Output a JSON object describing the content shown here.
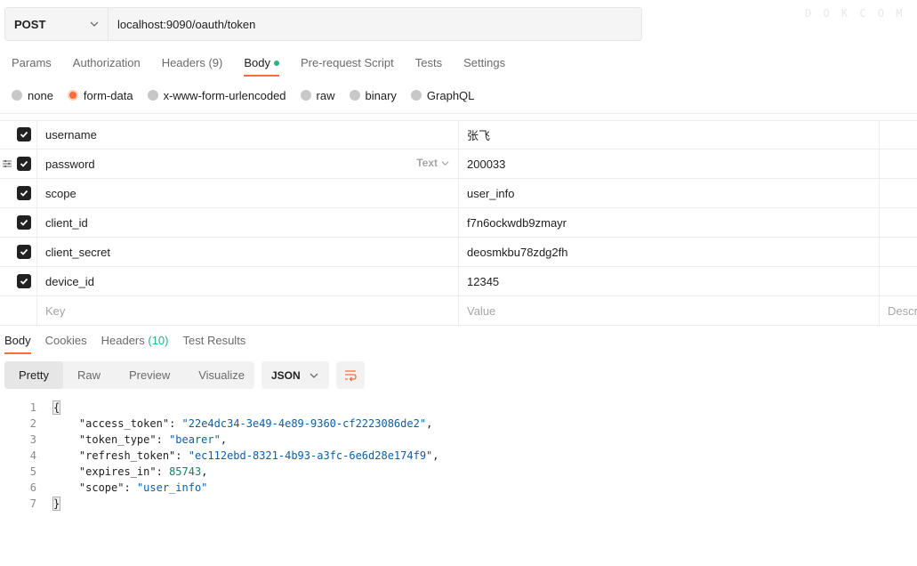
{
  "request": {
    "method": "POST",
    "url": "localhost:9090/oauth/token"
  },
  "watermark": "D O K C O M",
  "request_tabs": [
    {
      "label": "Params",
      "count": ""
    },
    {
      "label": "Authorization",
      "count": ""
    },
    {
      "label": "Headers",
      "count": "(9)"
    },
    {
      "label": "Body",
      "count": ""
    },
    {
      "label": "Pre-request Script",
      "count": ""
    },
    {
      "label": "Tests",
      "count": ""
    },
    {
      "label": "Settings",
      "count": ""
    }
  ],
  "body_types": [
    "none",
    "form-data",
    "x-www-form-urlencoded",
    "raw",
    "binary",
    "GraphQL"
  ],
  "form_rows": [
    {
      "key": "username",
      "value": "张飞"
    },
    {
      "key": "password",
      "value": "200033",
      "type": "Text"
    },
    {
      "key": "scope",
      "value": "user_info"
    },
    {
      "key": "client_id",
      "value": "f7n6ockwdb9zmayr"
    },
    {
      "key": "client_secret",
      "value": "deosmkbu78zdg2fh"
    },
    {
      "key": "device_id",
      "value": "12345"
    }
  ],
  "new_row": {
    "key": "Key",
    "value": "Value",
    "description": "Description"
  },
  "response_tabs": [
    {
      "label": "Body",
      "count": ""
    },
    {
      "label": "Cookies",
      "count": ""
    },
    {
      "label": "Headers",
      "count": "(10)"
    },
    {
      "label": "Test Results",
      "count": ""
    }
  ],
  "format_options": [
    "Pretty",
    "Raw",
    "Preview",
    "Visualize"
  ],
  "format_language": "JSON",
  "response_json": [
    {
      "num": "1",
      "key": "",
      "value": "",
      "kind": "open"
    },
    {
      "num": "2",
      "key": "\"access_token\"",
      "value": "\"22e4dc34-3e49-4e89-9360-cf2223086de2\"",
      "kind": "string",
      "comma": ","
    },
    {
      "num": "3",
      "key": "\"token_type\"",
      "value": "\"bearer\"",
      "kind": "string",
      "comma": ","
    },
    {
      "num": "4",
      "key": "\"refresh_token\"",
      "value": "\"ec112ebd-8321-4b93-a3fc-6e6d28e174f9\"",
      "kind": "string",
      "comma": ","
    },
    {
      "num": "5",
      "key": "\"expires_in\"",
      "value": "85743",
      "kind": "number",
      "comma": ","
    },
    {
      "num": "6",
      "key": "\"scope\"",
      "value": "\"user_info\"",
      "kind": "string",
      "comma": ""
    },
    {
      "num": "7",
      "key": "",
      "value": "",
      "kind": "close"
    }
  ],
  "colors": {
    "accent": "#ff6c37",
    "success": "#26b47f",
    "string": "#0b5fa8",
    "number": "#1a7f5a"
  }
}
